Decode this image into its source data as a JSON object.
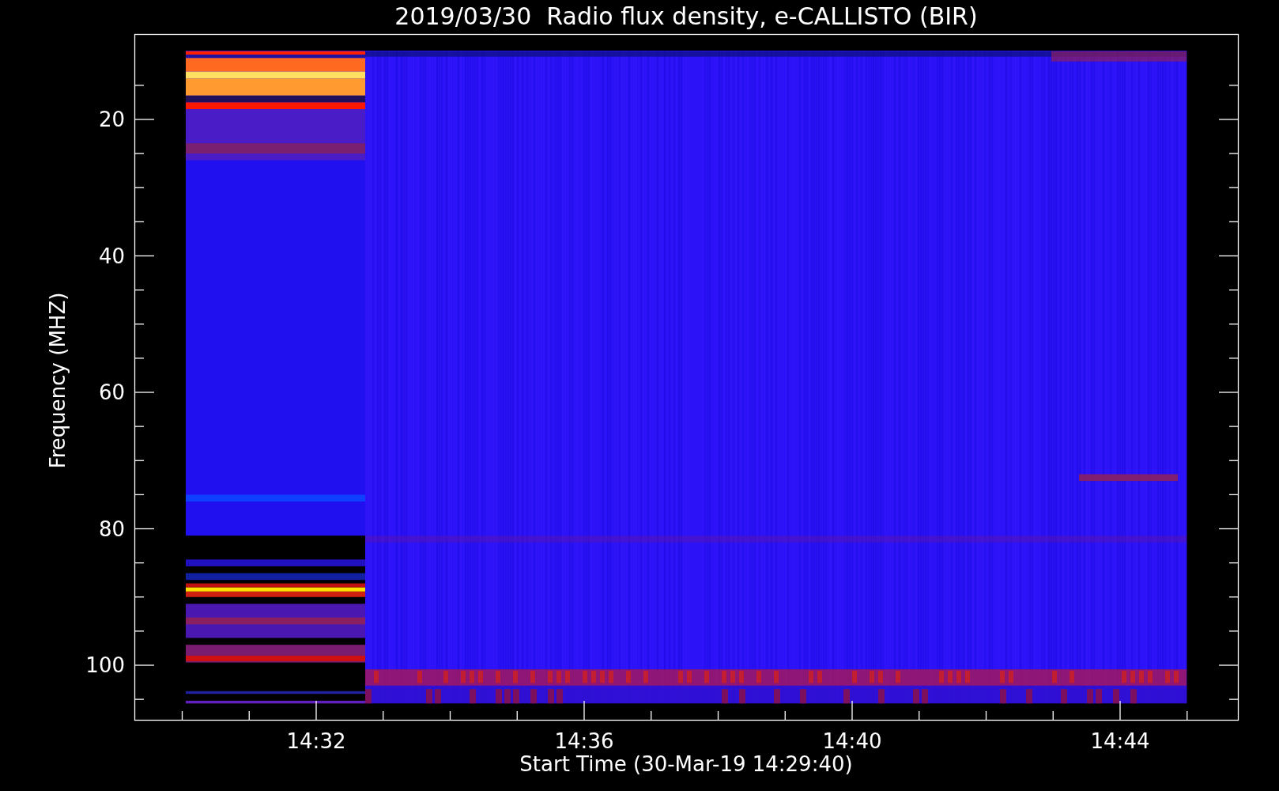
{
  "title": "2019/03/30  Radio flux density, e-CALLISTO (BIR)",
  "y_axis": {
    "label": "Frequency (MHZ)",
    "ticks": [
      "20",
      "40",
      "60",
      "80",
      "100"
    ]
  },
  "x_axis": {
    "label": "Start Time (30-Mar-19 14:29:40)",
    "ticks": [
      "14:32",
      "14:36",
      "14:40",
      "14:44"
    ]
  }
}
